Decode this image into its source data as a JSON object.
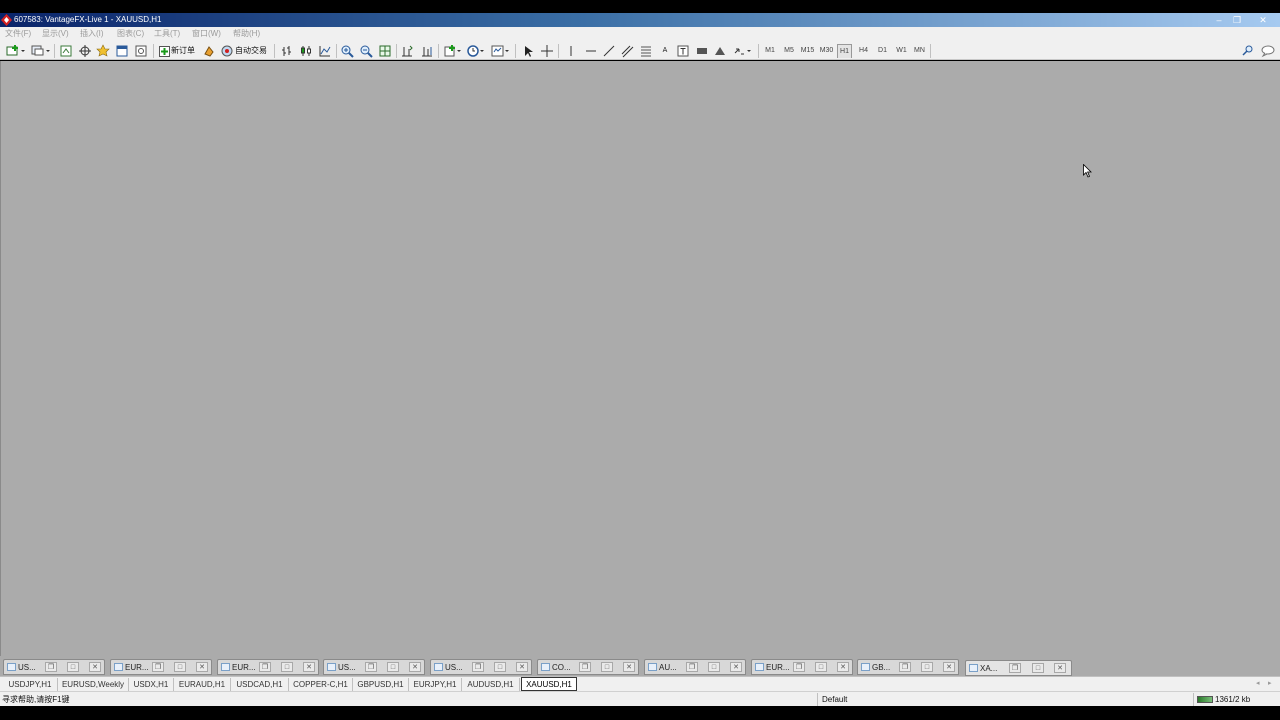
{
  "window": {
    "title": "607583: VantageFX-Live 1 - XAUUSD,H1",
    "minimize": "–",
    "restore": "❐",
    "close": "✕"
  },
  "menu": [
    "文件(F)",
    "显示(V)",
    "插入(I)",
    "图表(C)",
    "工具(T)",
    "窗口(W)",
    "帮助(H)"
  ],
  "toolbar": {
    "new_order_label": "新订单",
    "auto_trading_label": "自动交易",
    "periods": [
      "M1",
      "M5",
      "M15",
      "M30",
      "H1",
      "H4",
      "D1",
      "W1",
      "MN"
    ],
    "active_period": "H1",
    "drawing_text_tool": "A",
    "drawing_label_tool": "T"
  },
  "minimized_windows": [
    {
      "label": "US..."
    },
    {
      "label": "EUR..."
    },
    {
      "label": "EUR..."
    },
    {
      "label": "US..."
    },
    {
      "label": "US..."
    },
    {
      "label": "CO..."
    },
    {
      "label": "AU..."
    },
    {
      "label": "EUR..."
    },
    {
      "label": "GB..."
    },
    {
      "label": "XA..."
    }
  ],
  "chart_tabs": [
    "USDJPY,H1",
    "EURUSD,Weekly",
    "USDX,H1",
    "EURAUD,H1",
    "USDCAD,H1",
    "COPPER-C,H1",
    "GBPUSD,H1",
    "EURJPY,H1",
    "AUDUSD,H1",
    "XAUUSD,H1"
  ],
  "active_tab": "XAUUSD,H1",
  "status": {
    "help_text": "寻求帮助,请按F1键",
    "profile": "Default",
    "traffic": "1361/2 kb"
  },
  "colors": {
    "workspace": "#ababab",
    "title_gradient_start": "#0a246a",
    "title_gradient_end": "#a6caf0",
    "chrome": "#f0f0f0"
  }
}
